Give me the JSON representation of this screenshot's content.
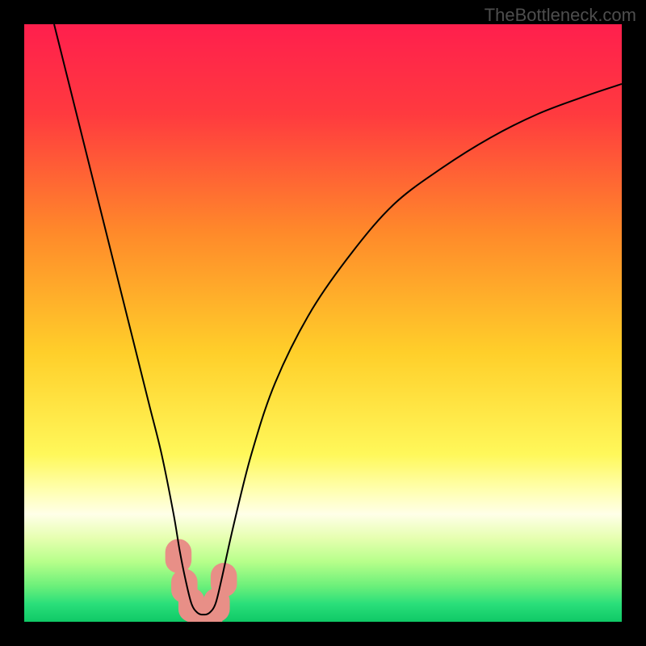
{
  "watermark": "TheBottleneck.com",
  "chart_data": {
    "type": "line",
    "title": "",
    "xlabel": "",
    "ylabel": "",
    "xlim": [
      0,
      100
    ],
    "ylim": [
      0,
      100
    ],
    "grid": false,
    "legend": false,
    "background_gradient_stops": [
      {
        "offset": 0.0,
        "color": "#ff1f4d"
      },
      {
        "offset": 0.15,
        "color": "#ff3a3f"
      },
      {
        "offset": 0.35,
        "color": "#ff8a2a"
      },
      {
        "offset": 0.55,
        "color": "#ffcf2a"
      },
      {
        "offset": 0.72,
        "color": "#fff85a"
      },
      {
        "offset": 0.78,
        "color": "#ffffb0"
      },
      {
        "offset": 0.82,
        "color": "#ffffe8"
      },
      {
        "offset": 0.86,
        "color": "#e6ffb0"
      },
      {
        "offset": 0.9,
        "color": "#b6ff8a"
      },
      {
        "offset": 0.94,
        "color": "#6cf07a"
      },
      {
        "offset": 0.97,
        "color": "#2adf7a"
      },
      {
        "offset": 1.0,
        "color": "#0fc966"
      }
    ],
    "series": [
      {
        "name": "bottleneck-curve",
        "color": "#000000",
        "x": [
          5,
          7,
          9,
          11,
          13,
          15,
          17,
          19,
          21,
          23,
          25,
          26,
          27,
          28,
          29,
          30,
          31,
          32,
          33,
          35,
          38,
          42,
          48,
          55,
          62,
          70,
          78,
          86,
          94,
          100
        ],
        "y": [
          100,
          92,
          84,
          76,
          68,
          60,
          52,
          44,
          36,
          28,
          18,
          12,
          7,
          3,
          1.5,
          1.2,
          1.5,
          3,
          7,
          16,
          28,
          40,
          52,
          62,
          70,
          76,
          81,
          85,
          88,
          90
        ]
      }
    ],
    "marker_region": {
      "name": "optimal-band",
      "color": "#e88f87",
      "points": [
        {
          "x": 25.8,
          "y": 11.0,
          "r": 2.2
        },
        {
          "x": 26.8,
          "y": 6.0,
          "r": 2.2
        },
        {
          "x": 28.0,
          "y": 2.8,
          "r": 2.2
        },
        {
          "x": 29.5,
          "y": 1.2,
          "r": 2.2
        },
        {
          "x": 31.0,
          "y": 1.2,
          "r": 2.2
        },
        {
          "x": 32.2,
          "y": 2.8,
          "r": 2.2
        },
        {
          "x": 33.4,
          "y": 7.0,
          "r": 2.2
        }
      ]
    }
  }
}
